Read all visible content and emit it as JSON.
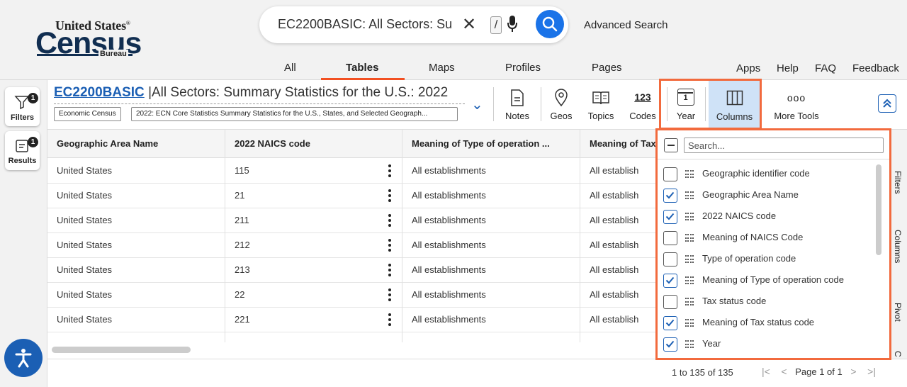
{
  "logo": {
    "line1": "United States",
    "line1_mark": "®",
    "line2": "Census",
    "line3": "Bureau"
  },
  "search": {
    "query": "EC2200BASIC: All Sectors: Su",
    "slash": "/",
    "advanced_label": "Advanced Search"
  },
  "nav_tabs": [
    "All",
    "Tables",
    "Maps",
    "Profiles",
    "Pages"
  ],
  "active_tab": "Tables",
  "top_links": [
    "Apps",
    "Help",
    "FAQ",
    "Feedback"
  ],
  "left_rail": {
    "filters_label": "Filters",
    "filters_badge": "1",
    "results_label": "Results",
    "results_badge": "1"
  },
  "table": {
    "id": "EC2200BASIC",
    "separator": "|",
    "name": "All Sectors: Summary Statistics for the U.S.: 2022",
    "chips": [
      "Economic Census",
      "2022: ECN Core Statistics Summary Statistics for the U.S., States, and Selected Geograph..."
    ]
  },
  "toolbar": {
    "notes": "Notes",
    "geos": "Geos",
    "topics": "Topics",
    "codes": "Codes",
    "codes_icon_text": "123",
    "year": "Year",
    "year_icon_text": "1",
    "columns": "Columns",
    "more_tools": "More Tools",
    "more_icon_text": "ooo"
  },
  "grid": {
    "headers": [
      "Geographic Area Name",
      "2022 NAICS code",
      "Meaning of Type of operation ...",
      "Meaning of Tax"
    ],
    "rows": [
      [
        "United States",
        "115",
        "All establishments",
        "All establish"
      ],
      [
        "United States",
        "21",
        "All establishments",
        "All establish"
      ],
      [
        "United States",
        "211",
        "All establishments",
        "All establish"
      ],
      [
        "United States",
        "212",
        "All establishments",
        "All establish"
      ],
      [
        "United States",
        "213",
        "All establishments",
        "All establish"
      ],
      [
        "United States",
        "22",
        "All establishments",
        "All establish"
      ],
      [
        "United States",
        "221",
        "All establishments",
        "All establish"
      ]
    ]
  },
  "footer": {
    "row_count": "1 to 135 of 135",
    "first": "|<",
    "prev": "<",
    "page_info": "Page 1 of 1",
    "next": ">",
    "last": ">|"
  },
  "side_tabs": [
    "Filters",
    "Columns",
    "Pivot",
    "C"
  ],
  "column_panel": {
    "search_placeholder": "Search...",
    "columns": [
      {
        "name": "Geographic identifier code",
        "checked": false
      },
      {
        "name": "Geographic Area Name",
        "checked": true
      },
      {
        "name": "2022 NAICS code",
        "checked": true
      },
      {
        "name": "Meaning of NAICS Code",
        "checked": false
      },
      {
        "name": "Type of operation code",
        "checked": false
      },
      {
        "name": "Meaning of Type of operation code",
        "checked": true
      },
      {
        "name": "Tax status code",
        "checked": false
      },
      {
        "name": "Meaning of Tax status code",
        "checked": true
      },
      {
        "name": "Year",
        "checked": true
      }
    ]
  },
  "colors": {
    "accent": "#1b5fb4",
    "highlight": "#f26a3d",
    "tab_underline": "#f25022"
  },
  "icons": [
    "filter-icon",
    "results-icon",
    "accessibility-icon",
    "search-icon",
    "mic-icon",
    "notes-icon",
    "geos-icon",
    "topics-icon",
    "columns-icon",
    "collapse-icon"
  ]
}
